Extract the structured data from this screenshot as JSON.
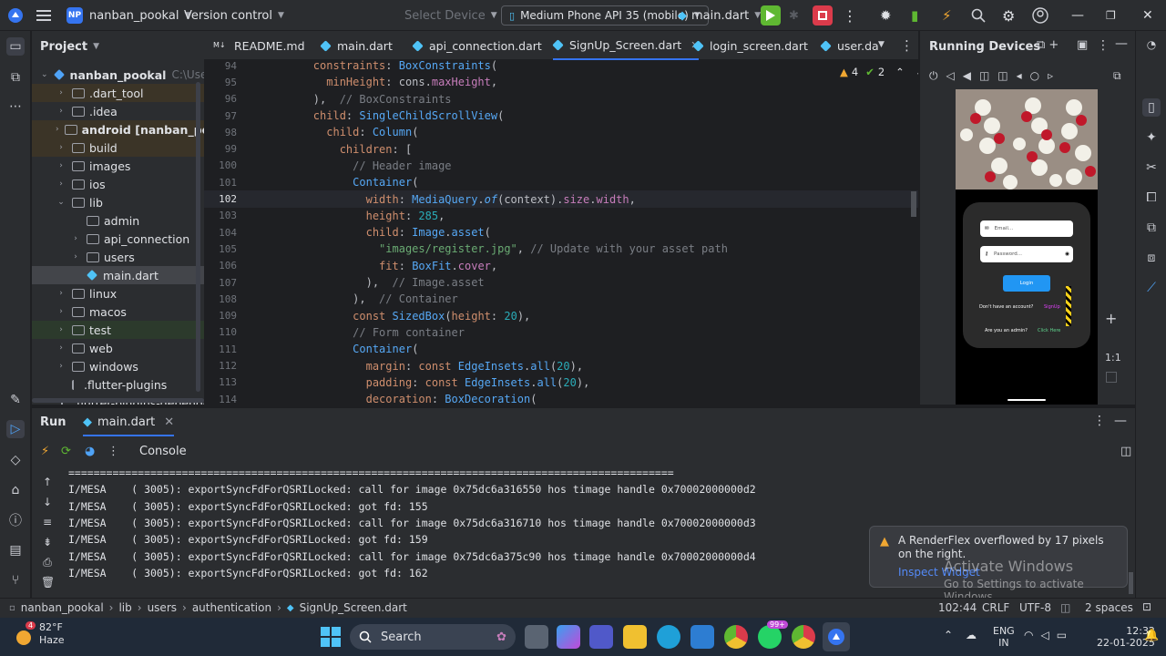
{
  "titlebar": {
    "project_initials": "NP",
    "project_name": "nanban_pookal",
    "vcs": "Version control",
    "select_device": "Select Device",
    "device": "Medium Phone API 35 (mobile)",
    "run_config": "main.dart"
  },
  "project_panel": {
    "title": "Project",
    "root": "nanban_pookal",
    "root_path": "C:\\Users\\A",
    "items": [
      {
        "label": ".dart_tool",
        "type": "folder",
        "indent": 1,
        "expandable": true
      },
      {
        "label": ".idea",
        "type": "folder",
        "indent": 1,
        "expandable": true
      },
      {
        "label": "android [nanban_pooka",
        "type": "folder",
        "indent": 1,
        "expandable": true
      },
      {
        "label": "build",
        "type": "folder",
        "indent": 1,
        "expandable": true
      },
      {
        "label": "images",
        "type": "folder",
        "indent": 1,
        "expandable": true
      },
      {
        "label": "ios",
        "type": "folder",
        "indent": 1,
        "expandable": true
      },
      {
        "label": "lib",
        "type": "folder",
        "indent": 1,
        "expandable": true,
        "expanded": true
      },
      {
        "label": "admin",
        "type": "folder",
        "indent": 2,
        "expandable": false
      },
      {
        "label": "api_connection",
        "type": "folder",
        "indent": 2,
        "expandable": true
      },
      {
        "label": "users",
        "type": "folder",
        "indent": 2,
        "expandable": true
      },
      {
        "label": "main.dart",
        "type": "dart",
        "indent": 2,
        "expandable": false,
        "selected": true
      },
      {
        "label": "linux",
        "type": "folder",
        "indent": 1,
        "expandable": true
      },
      {
        "label": "macos",
        "type": "folder",
        "indent": 1,
        "expandable": true
      },
      {
        "label": "test",
        "type": "folder",
        "indent": 1,
        "expandable": true
      },
      {
        "label": "web",
        "type": "folder",
        "indent": 1,
        "expandable": true
      },
      {
        "label": "windows",
        "type": "folder",
        "indent": 1,
        "expandable": true
      },
      {
        "label": ".flutter-plugins",
        "type": "file",
        "indent": 1,
        "expandable": false
      },
      {
        "label": ".flutter-plugins-dependen",
        "type": "file",
        "indent": 1,
        "expandable": false
      }
    ]
  },
  "tabs": [
    {
      "label": "README.md"
    },
    {
      "label": "main.dart"
    },
    {
      "label": "api_connection.dart"
    },
    {
      "label": "SignUp_Screen.dart",
      "active": true
    },
    {
      "label": "login_screen.dart"
    },
    {
      "label": "user.da"
    }
  ],
  "inspections": {
    "warnings": "4",
    "ok": "2"
  },
  "code_lines": [
    {
      "n": "94",
      "html": "        <span class='k'>constraints</span>: <span class='t'>BoxConstraints</span>("
    },
    {
      "n": "95",
      "html": "          <span class='k'>minHeight</span>: cons.<span class='f'>maxHeight</span>,"
    },
    {
      "n": "96",
      "html": "        ),  <span class='c'>// BoxConstraints</span>"
    },
    {
      "n": "97",
      "html": "        <span class='k'>child</span>: <span class='t'>SingleChildScrollView</span>("
    },
    {
      "n": "98",
      "html": "          <span class='k'>child</span>: <span class='t'>Column</span>("
    },
    {
      "n": "99",
      "html": "            <span class='k'>children</span>: ["
    },
    {
      "n": "100",
      "html": "              <span class='c'>// Header image</span>"
    },
    {
      "n": "101",
      "html": "              <span class='t'>Container</span>("
    },
    {
      "n": "102",
      "html": "                <span class='k'>width</span>: <span class='t'>MediaQuery</span>.<span class='m'><i>of</i></span>(context).<span class='f'>size</span>.<span class='f'>width</span>,"
    },
    {
      "n": "103",
      "html": "                <span class='k'>height</span>: <span class='n'>285</span>,"
    },
    {
      "n": "104",
      "html": "                <span class='k'>child</span>: <span class='t'>Image</span>.<span class='t'>asset</span>("
    },
    {
      "n": "105",
      "html": "                  <span class='s'>\"images/register.jpg\"</span>, <span class='c'>// Update with your asset path</span>"
    },
    {
      "n": "106",
      "html": "                  <span class='k'>fit</span>: <span class='t'>BoxFit</span>.<span class='f'>cover</span>,"
    },
    {
      "n": "107",
      "html": "                ),  <span class='c'>// Image.asset</span>"
    },
    {
      "n": "108",
      "html": "              ),  <span class='c'>// Container</span>"
    },
    {
      "n": "109",
      "html": "              <span class='k'>const</span> <span class='t'>SizedBox</span>(<span class='k'>height</span>: <span class='n'>20</span>),"
    },
    {
      "n": "110",
      "html": "              <span class='c'>// Form container</span>"
    },
    {
      "n": "111",
      "html": "              <span class='t'>Container</span>("
    },
    {
      "n": "112",
      "html": "                <span class='k'>margin</span>: <span class='k'>const</span> <span class='t'>EdgeInsets</span>.<span class='t'>all</span>(<span class='n'>20</span>),"
    },
    {
      "n": "113",
      "html": "                <span class='k'>padding</span>: <span class='k'>const</span> <span class='t'>EdgeInsets</span>.<span class='t'>all</span>(<span class='n'>20</span>),"
    },
    {
      "n": "114",
      "html": "                <span class='k'>decoration</span>: <span class='t'>BoxDecoration</span>("
    }
  ],
  "devices": {
    "title": "Running Devices",
    "zoom": "1:1",
    "app": {
      "email_placeholder": "Email...",
      "password_placeholder": "Password...",
      "login": "Login",
      "no_account": "Don't have an account?",
      "signup": "SignUp",
      "admin": "Are you an admin?",
      "click_here": "Click Here"
    }
  },
  "run": {
    "tab_label": "Run",
    "config": "main.dart",
    "console": "Console",
    "lines": [
      "================================================================================================",
      "I/MESA    ( 3005): exportSyncFdForQSRILocked: call for image 0x75dc6a316550 hos timage handle 0x70002000000d2",
      "I/MESA    ( 3005): exportSyncFdForQSRILocked: got fd: 155",
      "I/MESA    ( 3005): exportSyncFdForQSRILocked: call for image 0x75dc6a316710 hos timage handle 0x70002000000d3",
      "I/MESA    ( 3005): exportSyncFdForQSRILocked: got fd: 159",
      "I/MESA    ( 3005): exportSyncFdForQSRILocked: call for image 0x75dc6a375c90 hos timage handle 0x70002000000d4",
      "I/MESA    ( 3005): exportSyncFdForQSRILocked: got fd: 162"
    ]
  },
  "notification": {
    "message": "A RenderFlex overflowed by 17 pixels on the right.",
    "action": "Inspect Widget",
    "watermark_title": "Activate Windows",
    "watermark_sub": "Go to Settings to activate Windows."
  },
  "statusbar": {
    "breadcrumb": [
      "nanban_pookal",
      "lib",
      "users",
      "authentication",
      "SignUp_Screen.dart"
    ],
    "position": "102:44",
    "line_sep": "CRLF",
    "encoding": "UTF-8",
    "indent": "2 spaces"
  },
  "taskbar": {
    "weather_temp": "82°F",
    "weather_desc": "Haze",
    "weather_badge": "4",
    "search": "Search",
    "lang1": "ENG",
    "lang2": "IN",
    "time": "12:32",
    "date": "22-01-2025",
    "whatsapp_badge": "99+"
  }
}
